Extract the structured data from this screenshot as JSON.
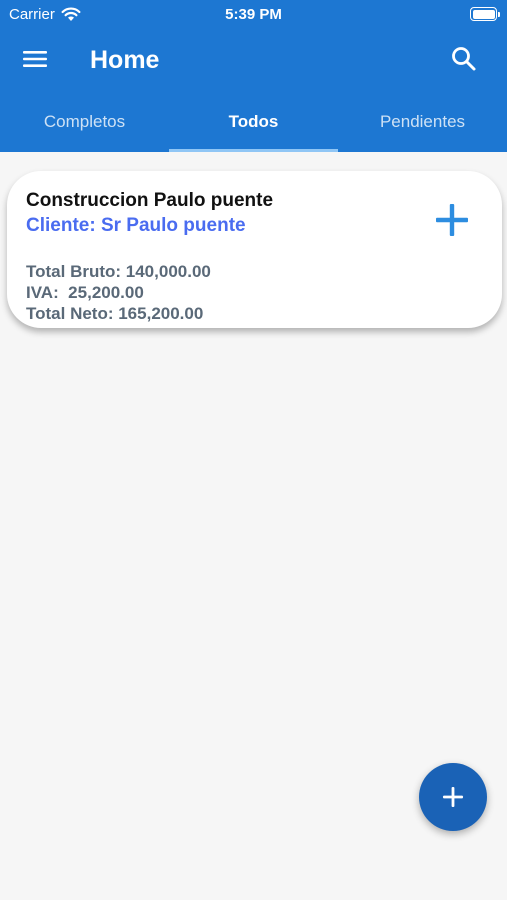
{
  "status_bar": {
    "carrier": "Carrier",
    "time": "5:39 PM"
  },
  "header": {
    "title": "Home",
    "menu_icon": "menu-icon",
    "search_icon": "search-icon"
  },
  "tabs": [
    {
      "label": "Completos",
      "active": false
    },
    {
      "label": "Todos",
      "active": true
    },
    {
      "label": "Pendientes",
      "active": false
    }
  ],
  "items": [
    {
      "title": "Construccion Paulo puente",
      "client": "Cliente: Sr Paulo puente",
      "total_bruto": "Total Bruto: 140,000.00",
      "iva": "IVA:  25,200.00",
      "total_neto": "Total Neto: 165,200.00"
    }
  ],
  "colors": {
    "primary": "#1d77d2",
    "fab": "#1a62b6",
    "client_text": "#4a6cf0",
    "totals_text": "#5a6978",
    "add_icon": "#2d8de0"
  }
}
